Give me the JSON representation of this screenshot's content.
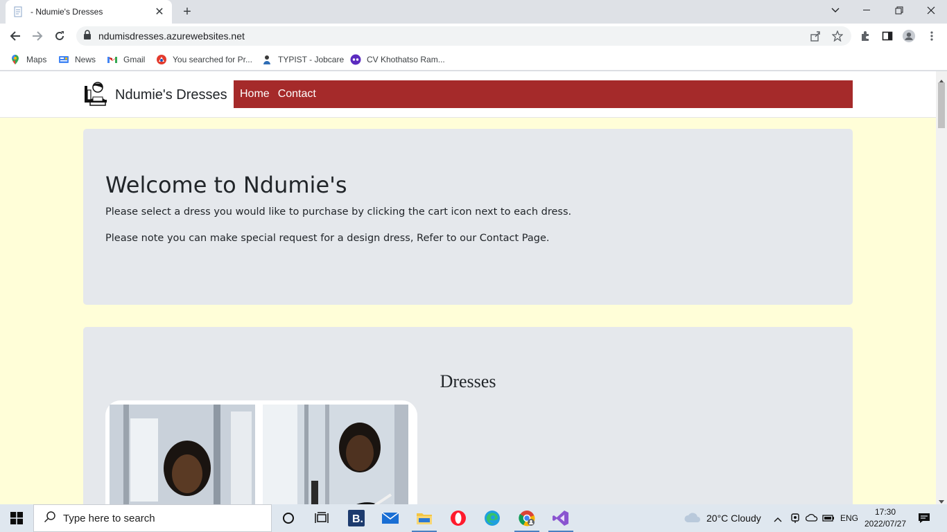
{
  "browser": {
    "tab_title": "- Ndumie's Dresses",
    "url": "ndumisdresses.azurewebsites.net",
    "bookmarks": [
      {
        "label": "Maps",
        "icon": "maps-icon"
      },
      {
        "label": "News",
        "icon": "news-icon"
      },
      {
        "label": "Gmail",
        "icon": "gmail-icon"
      },
      {
        "label": "You searched for Pr...",
        "icon": "site-icon"
      },
      {
        "label": "TYPIST - Jobcare",
        "icon": "jobcare-icon"
      },
      {
        "label": "CV Khothatso Ram...",
        "icon": "cv-icon"
      }
    ]
  },
  "site": {
    "brand": "Ndumie's Dresses",
    "nav": [
      "Home",
      "Contact"
    ],
    "nav_color": "#a52a2a",
    "page_bg": "#fffed8"
  },
  "jumbotron": {
    "heading": "Welcome to Ndumie's",
    "line1": "Please select a dress you would like to purchase by clicking the cart icon next to each dress.",
    "line2": "Please note you can make special request for a design dress, Refer to our Contact Page."
  },
  "dresses": {
    "title": "Dresses"
  },
  "taskbar": {
    "search_placeholder": "Type here to search",
    "weather": "20°C  Cloudy",
    "language": "ENG",
    "time": "17:30",
    "date": "2022/07/27"
  }
}
